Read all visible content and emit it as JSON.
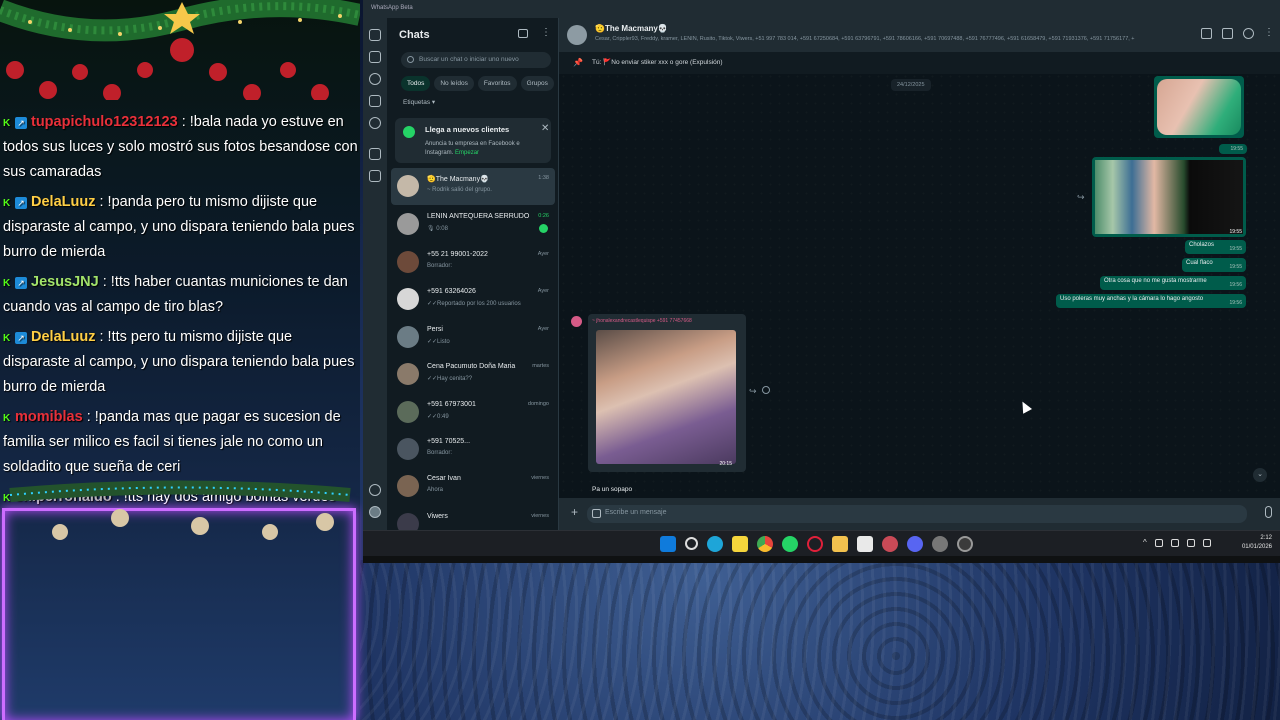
{
  "overlay": {
    "messages": [
      {
        "user": "tupapichulo12312123",
        "color": "#e8303a",
        "text": ": !bala nada yo estuve en todos sus luces y solo mostró sus fotos besandose con sus camaradas",
        "badges": 2
      },
      {
        "user": "DelaLuuz",
        "color": "#ffcf45",
        "text": ": !panda pero tu mismo dijiste que disparaste al campo, y uno dispara teniendo bala pues burro de mierda",
        "badges": 2
      },
      {
        "user": "JesusJNJ",
        "color": "#a2e36a",
        "text": ": !tts haber cuantas municiones te dan cuando vas al campo de tiro blas?",
        "badges": 2
      },
      {
        "user": "DelaLuuz",
        "color": "#ffcf45",
        "text": ": !tts pero tu mismo dijiste que disparaste al campo, y uno dispara teniendo bala pues burro de mierda",
        "badges": 2
      },
      {
        "user": "momiblas",
        "color": "#e8303a",
        "text": ": !panda mas que pagar es sucesion de familia ser milico es facil si tienes jale no como un soldadito que sueña de ceri",
        "badges": 1
      },
      {
        "user": "sniperronaldo",
        "color": "#b8b8b8",
        "text": ": !tts hay dos amigo boinas verdes",
        "badges": 1
      }
    ]
  },
  "whatsapp": {
    "window_title": "WhatsApp Beta",
    "sidebar": {
      "title": "Chats",
      "search_placeholder": "Buscar un chat o iniciar uno nuevo",
      "filters": [
        "Todos",
        "No leídos",
        "Favoritos",
        "Grupos"
      ],
      "labels": "Etiquetas",
      "promo": {
        "title": "Llega a nuevos clientes",
        "text": "Anuncia tu empresa en Facebook e Instagram.",
        "link": "Empezar"
      },
      "chats": [
        {
          "name": "🫡The Macmany💀",
          "preview": "~ Rodrik salió del grupo.",
          "time": "1:38"
        },
        {
          "name": "LENIN ANTEQUERA SERRUDO",
          "preview": "🎙 0:08",
          "time": "0:26",
          "unread": true
        },
        {
          "name": "+55 21 99001-2022",
          "preview": "Borrador:",
          "time": "Ayer"
        },
        {
          "name": "+591 63264026",
          "preview": "✓✓Reportado por los 200 usuarios",
          "time": "Ayer"
        },
        {
          "name": "Persi",
          "preview": "✓✓Listo",
          "time": "Ayer"
        },
        {
          "name": "Cena Pacumuto Doña Maria",
          "preview": "✓✓Hay cenita??",
          "time": "martes"
        },
        {
          "name": "+591 67973001",
          "preview": "✓✓0:49",
          "time": "domingo"
        },
        {
          "name": "+591 70525...",
          "preview": "Borrador:",
          "time": ""
        },
        {
          "name": "Cesar Ivan",
          "preview": "Ahora",
          "time": "viernes"
        },
        {
          "name": "Viwers",
          "preview": "",
          "time": "viernes"
        }
      ]
    },
    "conversation": {
      "title": "🫡The Macmany💀",
      "members": "Cesar, Crippler93, Freddy, kramer, LENIN, Rusito, Tiktok, Viwers, +51 997 783 014, +591 67250684, +591 63796791, +591 78606166, +591 70697488, +591 76777496, +591 61658479, +591 71931376, +591 71756177, +",
      "pinned": "Tú: 🚩No enviar stiker xxx o gore (Expulsión)",
      "date": "24/12/2025",
      "outgoing": [
        {
          "text": "Cholazos",
          "time": "19:55"
        },
        {
          "text": "Cual flaco",
          "time": "19:55"
        },
        {
          "text": "Otra cosa que no me gusta mostrarme",
          "time": "19:56"
        },
        {
          "text": "Uso poleras muy anchas y la cámara lo hago angosto",
          "time": "19:56"
        }
      ],
      "img_time_1": "19:55",
      "img_time_2": "19:55",
      "incoming_sender": "~ jhonalexandrecastlequispe  +591 77457668",
      "incoming_time": "20:15",
      "incoming_caption": "Pa un sopapo",
      "composer_placeholder": "Escribe un mensaje"
    },
    "taskbar": {
      "time": "2:12",
      "date": "01/01/2026"
    }
  }
}
